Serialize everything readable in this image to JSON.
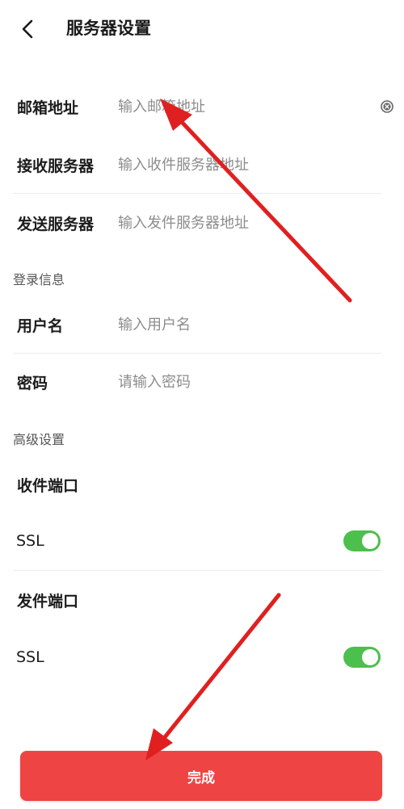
{
  "header": {
    "title": "服务器设置",
    "back_icon": "chevron-left-icon"
  },
  "server": {
    "email": {
      "label": "邮箱地址",
      "placeholder": "输入邮箱地址"
    },
    "incoming": {
      "label": "接收服务器",
      "placeholder": "输入收件服务器地址"
    },
    "outgoing": {
      "label": "发送服务器",
      "placeholder": "输入发件服务器地址"
    }
  },
  "login": {
    "section_title": "登录信息",
    "username": {
      "label": "用户名",
      "placeholder": "输入用户名"
    },
    "password": {
      "label": "密码",
      "placeholder": "请输入密码"
    }
  },
  "advanced": {
    "section_title": "高级设置",
    "incoming_port": {
      "label": "收件端口",
      "ssl_label": "SSL",
      "ssl_on": true
    },
    "outgoing_port": {
      "label": "发件端口",
      "ssl_label": "SSL",
      "ssl_on": true
    }
  },
  "footer": {
    "done_label": "完成"
  },
  "colors": {
    "accent": "#ee4444",
    "toggle_on": "#4cbf4c",
    "annotation_arrow": "#e02020"
  }
}
